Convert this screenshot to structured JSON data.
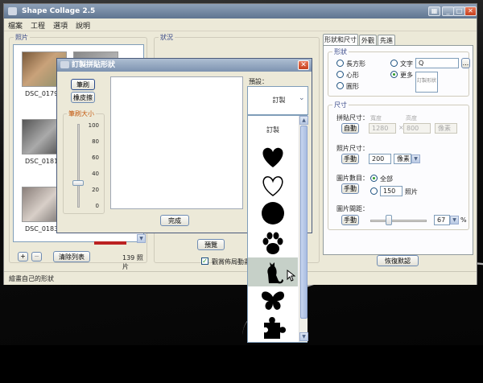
{
  "window": {
    "title": "Shape Collage 2.5"
  },
  "menu": [
    "檔案",
    "工程",
    "選項",
    "說明"
  ],
  "photos": {
    "label": "照片",
    "items": [
      {
        "name": "DSC_0179.J"
      },
      {
        "name": "DSC_0181.J"
      },
      {
        "name": "DSC_0183.J"
      }
    ],
    "clear_label": "清除列表",
    "count": "139 照片"
  },
  "status_label": "狀況",
  "preview_label": "預覽",
  "animate_label": "觀賞佈局動畫",
  "status_bar": "繪畫自己的形狀",
  "tabs": [
    "形狀和尺寸",
    "外觀",
    "先進"
  ],
  "shape": {
    "label": "形狀",
    "options": [
      "長方形",
      "心形",
      "圓形",
      "文字",
      "更多"
    ],
    "text_value": "Q",
    "custom_label": "訂製形狀"
  },
  "size": {
    "label": "尺寸",
    "collage_size_label": "拼貼尺寸：",
    "auto_label": "自動",
    "width_label": "寬度",
    "height_label": "高度",
    "width": "1280",
    "height": "800",
    "unit": "像素",
    "photo_size_label": "照片尺寸：",
    "manual_label": "手動",
    "photo_size": "200",
    "photo_unit": "像素",
    "photo_count_label": "圖片數目：",
    "all_label": "全部",
    "count_value": "150",
    "count_unit": "照片",
    "spacing_label": "圖片間距：",
    "spacing_value": "67",
    "spacing_unit": "%",
    "spacing_level": 0.3
  },
  "reset_label": "恢復默認",
  "dialog": {
    "title": "訂製拼貼形狀",
    "brush_label": "筆刷",
    "eraser_label": "橡皮擦",
    "brush_size_label": "筆刷大小",
    "ticks": [
      "100",
      "80",
      "60",
      "40",
      "20",
      "0"
    ],
    "brush_level": 0.3,
    "preset_label": "預設：",
    "preset_value": "訂製",
    "done_label": "完成",
    "dropdown_items": [
      "訂製"
    ],
    "dropdown_shapes": [
      "heart-shape",
      "heart-outline-shape",
      "circle-shape",
      "paw-shape",
      "cat-shape",
      "butterfly-shape",
      "puzzle-shape"
    ]
  }
}
